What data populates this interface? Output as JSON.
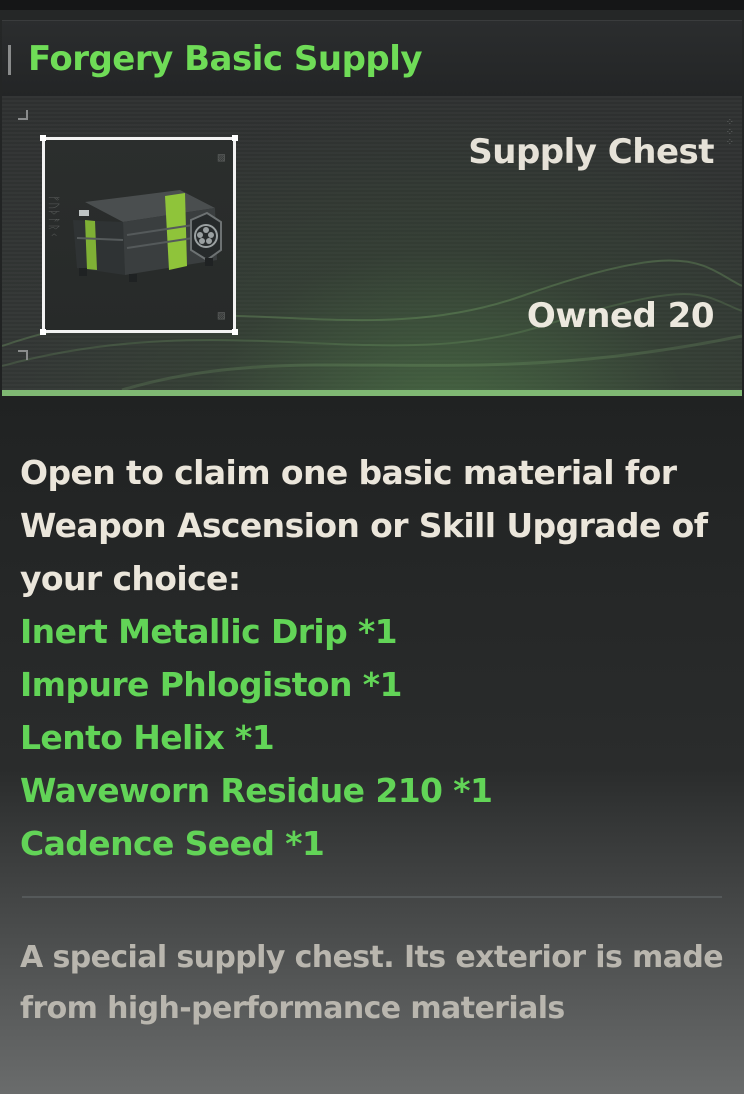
{
  "item": {
    "title": "Forgery Basic Supply",
    "type": "Supply Chest",
    "owned": "Owned 20",
    "icon": "supply-chest-icon"
  },
  "description": {
    "intro": "Open to claim one basic material for Weapon Ascension or Skill Upgrade of your choice:",
    "materials": [
      "Inert Metallic Drip *1",
      "Impure Phlogiston *1",
      "Lento Helix *1",
      "Waveworn Residue 210 *1",
      "Cadence Seed *1"
    ],
    "flavor": "A special supply chest. Its exterior is made from high-performance materials"
  },
  "colors": {
    "title_green": "#6fdc57",
    "material_green": "#62d457",
    "accent_line": "#7fb873"
  }
}
